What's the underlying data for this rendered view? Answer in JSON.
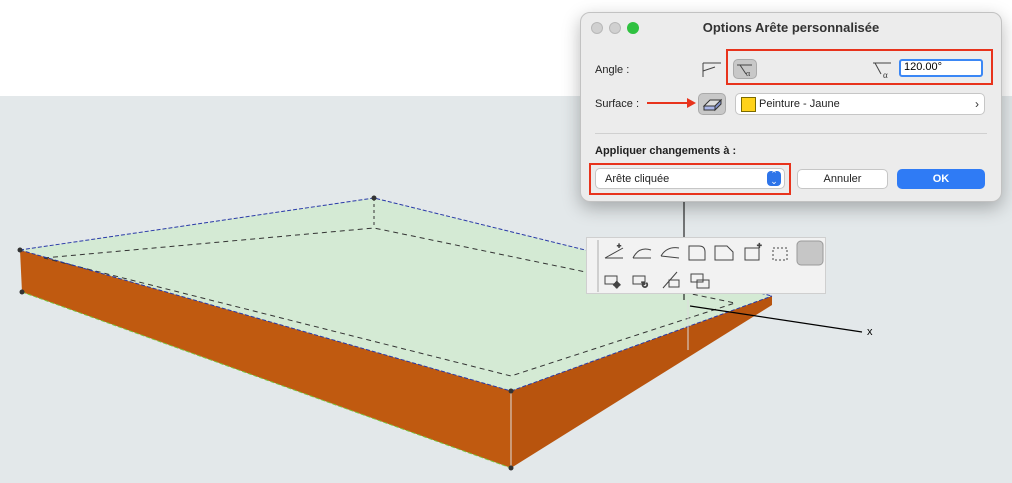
{
  "dialog": {
    "title": "Options Arête personnalisée",
    "angle_label": "Angle :",
    "angle_value": "120.00°",
    "surface_label": "Surface :",
    "surface_value": "Peinture - Jaune",
    "surface_color": "#ffd21a",
    "section_title": "Appliquer changements à :",
    "apply_value": "Arête cliquée",
    "cancel_label": "Annuler",
    "ok_label": "OK"
  },
  "scene": {
    "axis_label": "x",
    "slab_side_color": "#c05a10",
    "slab_top_color": "#d4ead4",
    "background_color": "#e3e8ea"
  },
  "palette": {
    "tools": [
      "edge-angle-tool",
      "edge-arc-tool",
      "edge-curve-tool",
      "fillet-tool",
      "chamfer-tool",
      "add-vertex-tool",
      "offset-edge-tool",
      "custom-edge-tool",
      "move-tool",
      "rotate-tool",
      "mirror-tool",
      "elevate-tool"
    ]
  },
  "accent_color": "#e8331c"
}
